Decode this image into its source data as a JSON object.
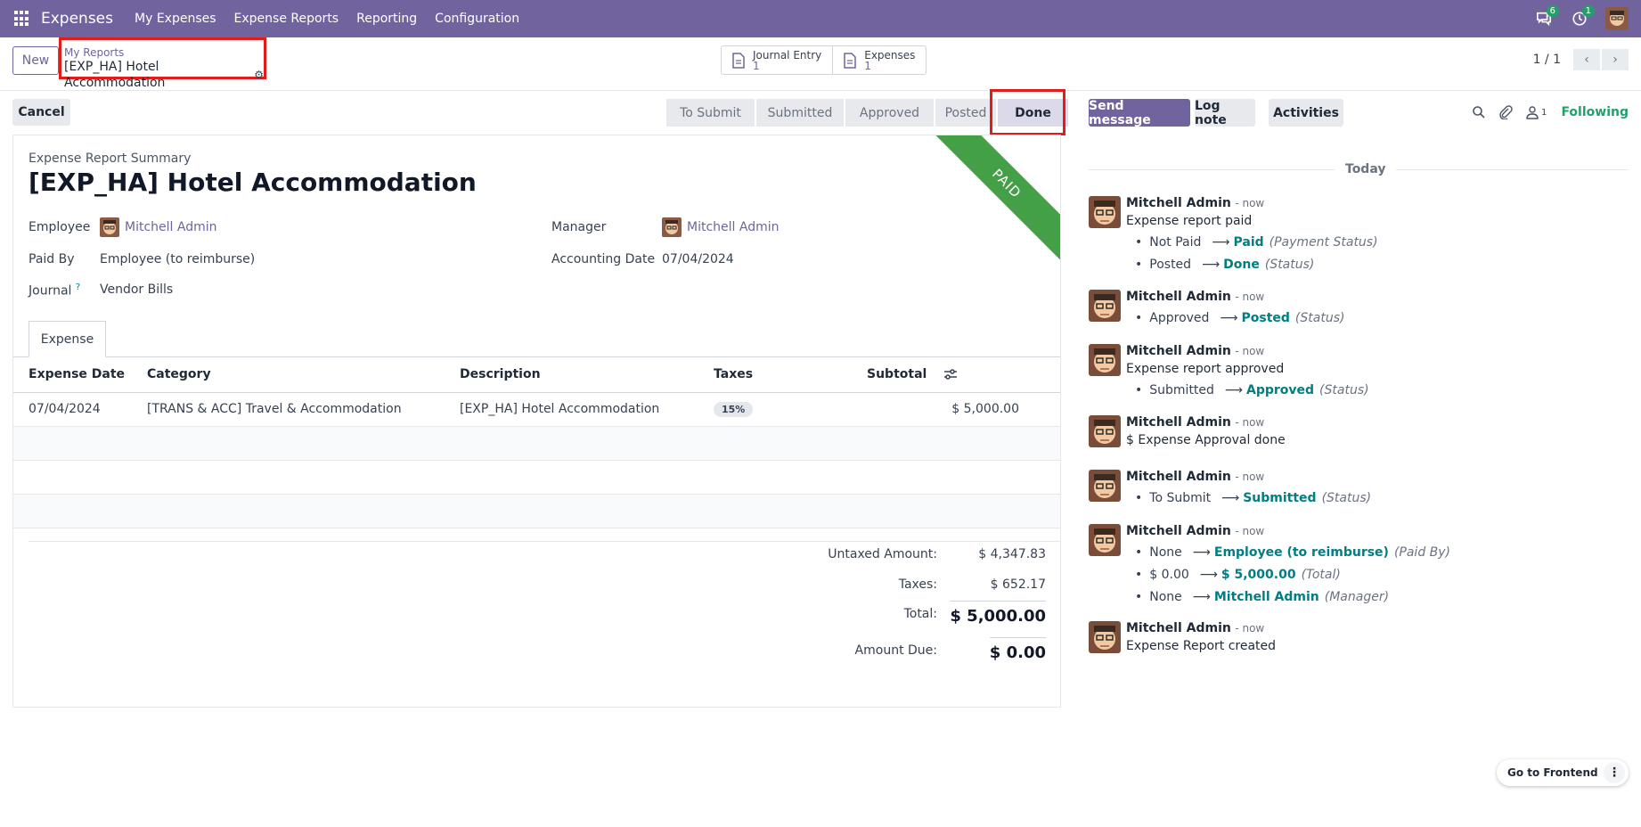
{
  "navbar": {
    "app_name": "Expenses",
    "menu": [
      "My Expenses",
      "Expense Reports",
      "Reporting",
      "Configuration"
    ],
    "chat_badge": "6",
    "activity_badge": "1",
    "color": "#71639e"
  },
  "control": {
    "new_label": "New",
    "breadcrumb_parent": "My Reports",
    "breadcrumb_current": "[EXP_HA] Hotel Accommodation",
    "smart_buttons": [
      {
        "label": "Journal Entry",
        "count": "1",
        "icon": "document-icon"
      },
      {
        "label": "Expenses",
        "count": "1",
        "icon": "document-icon"
      }
    ],
    "pager": "1 / 1"
  },
  "status": {
    "cancel_label": "Cancel",
    "stages": [
      "To Submit",
      "Submitted",
      "Approved",
      "Posted",
      "Done"
    ],
    "active_stage": "Done"
  },
  "form": {
    "ribbon": "PAID",
    "summary_label": "Expense Report Summary",
    "title": "[EXP_HA] Hotel Accommodation",
    "employee_label": "Employee",
    "employee_value": "Mitchell Admin",
    "paid_by_label": "Paid By",
    "paid_by_value": "Employee (to reimburse)",
    "journal_label": "Journal",
    "journal_help": "?",
    "journal_value": "Vendor Bills",
    "manager_label": "Manager",
    "manager_value": "Mitchell Admin",
    "accounting_date_label": "Accounting Date",
    "accounting_date_value": "07/04/2024",
    "tab_label": "Expense",
    "table": {
      "headers": [
        "Expense Date",
        "Category",
        "Description",
        "Taxes",
        "Subtotal"
      ],
      "rows": [
        {
          "date": "07/04/2024",
          "category": "[TRANS & ACC] Travel & Accommodation",
          "description": "[EXP_HA] Hotel Accommodation",
          "taxes": "15%",
          "subtotal": "$ 5,000.00"
        }
      ]
    },
    "totals": {
      "untaxed_label": "Untaxed Amount:",
      "untaxed_value": "$ 4,347.83",
      "taxes_label": "Taxes:",
      "taxes_value": "$ 652.17",
      "total_label": "Total:",
      "total_value": "$ 5,000.00",
      "due_label": "Amount Due:",
      "due_value": "$ 0.00"
    }
  },
  "chatter": {
    "send_message": "Send message",
    "log_note": "Log note",
    "activities": "Activities",
    "followers_count": "1",
    "following": "Following",
    "today": "Today",
    "messages": [
      {
        "author": "Mitchell Admin",
        "date": "- now",
        "text": "Expense report paid",
        "changes": [
          {
            "old": "Not Paid",
            "new": "Paid",
            "field": "(Payment Status)"
          },
          {
            "old": "Posted",
            "new": "Done",
            "field": "(Status)"
          }
        ]
      },
      {
        "author": "Mitchell Admin",
        "date": "- now",
        "text": "",
        "changes": [
          {
            "old": "Approved",
            "new": "Posted",
            "field": "(Status)"
          }
        ]
      },
      {
        "author": "Mitchell Admin",
        "date": "- now",
        "text": "Expense report approved",
        "changes": [
          {
            "old": "Submitted",
            "new": "Approved",
            "field": "(Status)"
          }
        ]
      },
      {
        "author": "Mitchell Admin",
        "date": "- now",
        "text": "$ Expense Approval done",
        "changes": []
      },
      {
        "author": "Mitchell Admin",
        "date": "- now",
        "text": "",
        "changes": [
          {
            "old": "To Submit",
            "new": "Submitted",
            "field": "(Status)"
          }
        ]
      },
      {
        "author": "Mitchell Admin",
        "date": "- now",
        "text": "",
        "changes": [
          {
            "old": "None",
            "new": "Employee (to reimburse)",
            "field": "(Paid By)"
          },
          {
            "old": "$ 0.00",
            "new": "$ 5,000.00",
            "field": "(Total)"
          },
          {
            "old": "None",
            "new": "Mitchell Admin",
            "field": "(Manager)"
          }
        ]
      },
      {
        "author": "Mitchell Admin",
        "date": "- now",
        "text": "Expense Report created",
        "changes": []
      }
    ],
    "arrow": "⟶"
  },
  "footer": {
    "frontend_label": "Go to Frontend",
    "more_icon": "⋮"
  }
}
